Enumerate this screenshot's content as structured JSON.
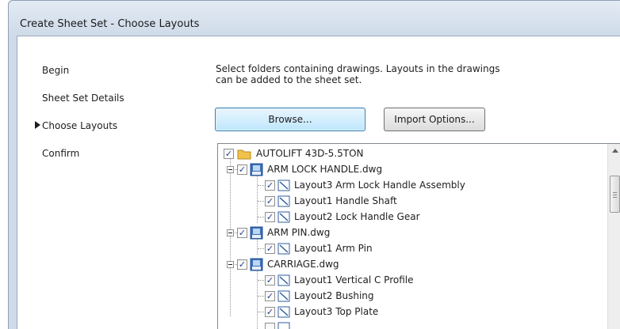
{
  "window": {
    "title": "Create Sheet Set - Choose Layouts"
  },
  "nav": {
    "items": [
      {
        "label": "Begin",
        "active": false
      },
      {
        "label": "Sheet Set Details",
        "active": false
      },
      {
        "label": "Choose Layouts",
        "active": true
      },
      {
        "label": "Confirm",
        "active": false
      }
    ]
  },
  "instructions": "Select folders containing drawings.  Layouts in the drawings can be added to the sheet set.",
  "buttons": {
    "browse": "Browse...",
    "import_options": "Import Options..."
  },
  "tree": {
    "root": {
      "label": "AUTOLIFT 43D-5.5TON",
      "checked": true
    },
    "drawings": [
      {
        "label": "ARM LOCK HANDLE.dwg",
        "checked": true,
        "expanded": true,
        "layouts": [
          {
            "label": "Layout3 Arm Lock Handle Assembly",
            "checked": true
          },
          {
            "label": "Layout1 Handle Shaft",
            "checked": true
          },
          {
            "label": "Layout2 Lock Handle Gear",
            "checked": true
          }
        ]
      },
      {
        "label": "ARM PIN.dwg",
        "checked": true,
        "expanded": true,
        "layouts": [
          {
            "label": "Layout1 Arm Pin",
            "checked": true
          }
        ]
      },
      {
        "label": "CARRIAGE.dwg",
        "checked": true,
        "expanded": true,
        "layouts": [
          {
            "label": "Layout1 Vertical C Profile",
            "checked": true
          },
          {
            "label": "Layout2 Bushing",
            "checked": true
          },
          {
            "label": "Layout3 Top Plate",
            "checked": true
          }
        ]
      }
    ]
  },
  "colors": {
    "accent_blue": "#3c7fb1",
    "folder_yellow": "#f0c24a",
    "check_mark": "#2a3f8f"
  },
  "icons": {
    "root": "folder-icon",
    "drawing": "dwg-file-icon",
    "layout": "layout-icon"
  }
}
